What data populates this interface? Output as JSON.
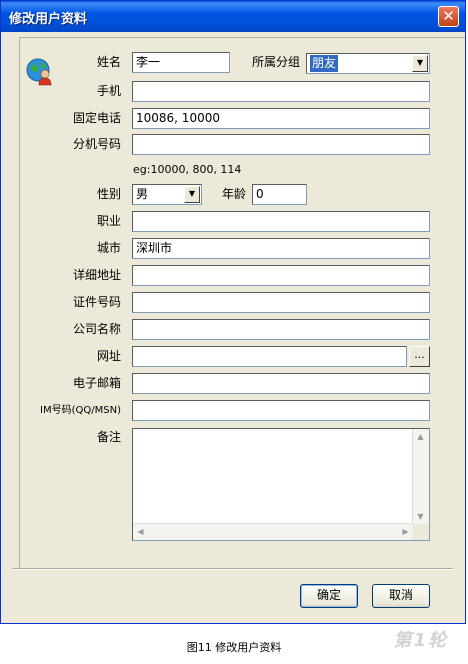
{
  "window": {
    "title": "修改用户资料"
  },
  "form": {
    "name": {
      "label": "姓名",
      "value": "李一"
    },
    "group": {
      "label": "所属分组",
      "value": "朋友"
    },
    "mobile": {
      "label": "手机",
      "value": ""
    },
    "phone": {
      "label": "固定电话",
      "value": "10086, 10000"
    },
    "extension": {
      "label": "分机号码",
      "value": "",
      "hint": "eg:10000, 800, 114"
    },
    "gender": {
      "label": "性别",
      "value": "男"
    },
    "age": {
      "label": "年龄",
      "value": "0"
    },
    "job": {
      "label": "职业",
      "value": ""
    },
    "city": {
      "label": "城市",
      "value": "深圳市"
    },
    "address": {
      "label": "详细地址",
      "value": ""
    },
    "id_number": {
      "label": "证件号码",
      "value": ""
    },
    "company": {
      "label": "公司名称",
      "value": ""
    },
    "website": {
      "label": "网址",
      "value": "",
      "browse_label": "..."
    },
    "email": {
      "label": "电子邮箱",
      "value": ""
    },
    "im": {
      "label": "IM号码(QQ/MSN)",
      "value": ""
    },
    "notes": {
      "label": "备注",
      "value": ""
    }
  },
  "buttons": {
    "ok": "确定",
    "cancel": "取消"
  },
  "caption": "图11  修改用户资料",
  "watermark": "第1轮",
  "icons": {
    "avatar": "user-globe-icon",
    "close": "close-icon",
    "dropdown": "chevron-down-icon"
  },
  "colors": {
    "titlebar": "#0054e3",
    "dialog_bg": "#ece9d8",
    "selection": "#316ac5"
  }
}
